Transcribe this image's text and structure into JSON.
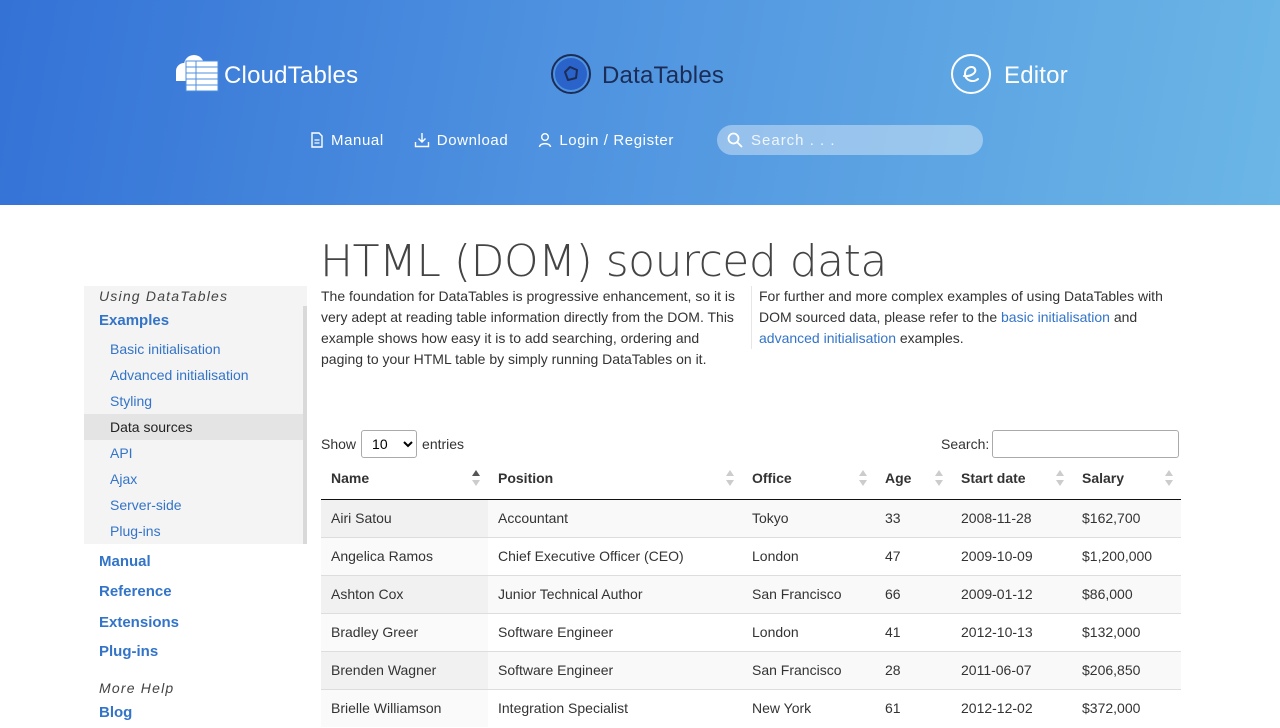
{
  "header": {
    "brands": [
      {
        "label": "CloudTables"
      },
      {
        "label": "DataTables"
      },
      {
        "label": "Editor"
      }
    ],
    "nav": [
      {
        "label": "Manual",
        "icon": "document-icon"
      },
      {
        "label": "Download",
        "icon": "download-icon"
      },
      {
        "label": "Login / Register",
        "icon": "user-icon"
      }
    ],
    "search_placeholder": "Search . . .",
    "gradient_colors": [
      "#3472d6",
      "#6bb6e6"
    ]
  },
  "sidebar": {
    "heading": "Using DataTables",
    "examples_label": "Examples",
    "sub_items": [
      {
        "label": "Basic initialisation"
      },
      {
        "label": "Advanced initialisation"
      },
      {
        "label": "Styling"
      },
      {
        "label": "Data sources"
      },
      {
        "label": "API"
      },
      {
        "label": "Ajax"
      },
      {
        "label": "Server-side"
      },
      {
        "label": "Plug-ins"
      }
    ],
    "active_item": "Data sources",
    "top_items": [
      {
        "label": "Manual"
      },
      {
        "label": "Reference"
      },
      {
        "label": "Extensions"
      },
      {
        "label": "Plug-ins"
      }
    ],
    "more_heading": "More Help",
    "blog_label": "Blog",
    "link_color": "#3374c8"
  },
  "main": {
    "title": "HTML (DOM) sourced data",
    "intro_left": "The foundation for DataTables is progressive enhancement, so it is very adept at reading table information directly from the DOM. This example shows how easy it is to add searching, ordering and paging to your HTML table by simply running DataTables on it.",
    "intro_right_pre": "For further and more complex examples of using DataTables with DOM sourced data, please refer to the ",
    "intro_right_link1": "basic initialisation",
    "intro_right_mid": " and ",
    "intro_right_link2": "advanced initialisation",
    "intro_right_post": " examples.",
    "length": {
      "show": "Show",
      "value": "10",
      "entries": "entries"
    },
    "filter_label": "Search:",
    "filter_value": ""
  },
  "table": {
    "columns": [
      "Name",
      "Position",
      "Office",
      "Age",
      "Start date",
      "Salary"
    ],
    "sorted_column": "Name",
    "rows": [
      [
        "Airi Satou",
        "Accountant",
        "Tokyo",
        "33",
        "2008-11-28",
        "$162,700"
      ],
      [
        "Angelica Ramos",
        "Chief Executive Officer (CEO)",
        "London",
        "47",
        "2009-10-09",
        "$1,200,000"
      ],
      [
        "Ashton Cox",
        "Junior Technical Author",
        "San Francisco",
        "66",
        "2009-01-12",
        "$86,000"
      ],
      [
        "Bradley Greer",
        "Software Engineer",
        "London",
        "41",
        "2012-10-13",
        "$132,000"
      ],
      [
        "Brenden Wagner",
        "Software Engineer",
        "San Francisco",
        "28",
        "2011-06-07",
        "$206,850"
      ],
      [
        "Brielle Williamson",
        "Integration Specialist",
        "New York",
        "61",
        "2012-12-02",
        "$372,000"
      ]
    ]
  }
}
